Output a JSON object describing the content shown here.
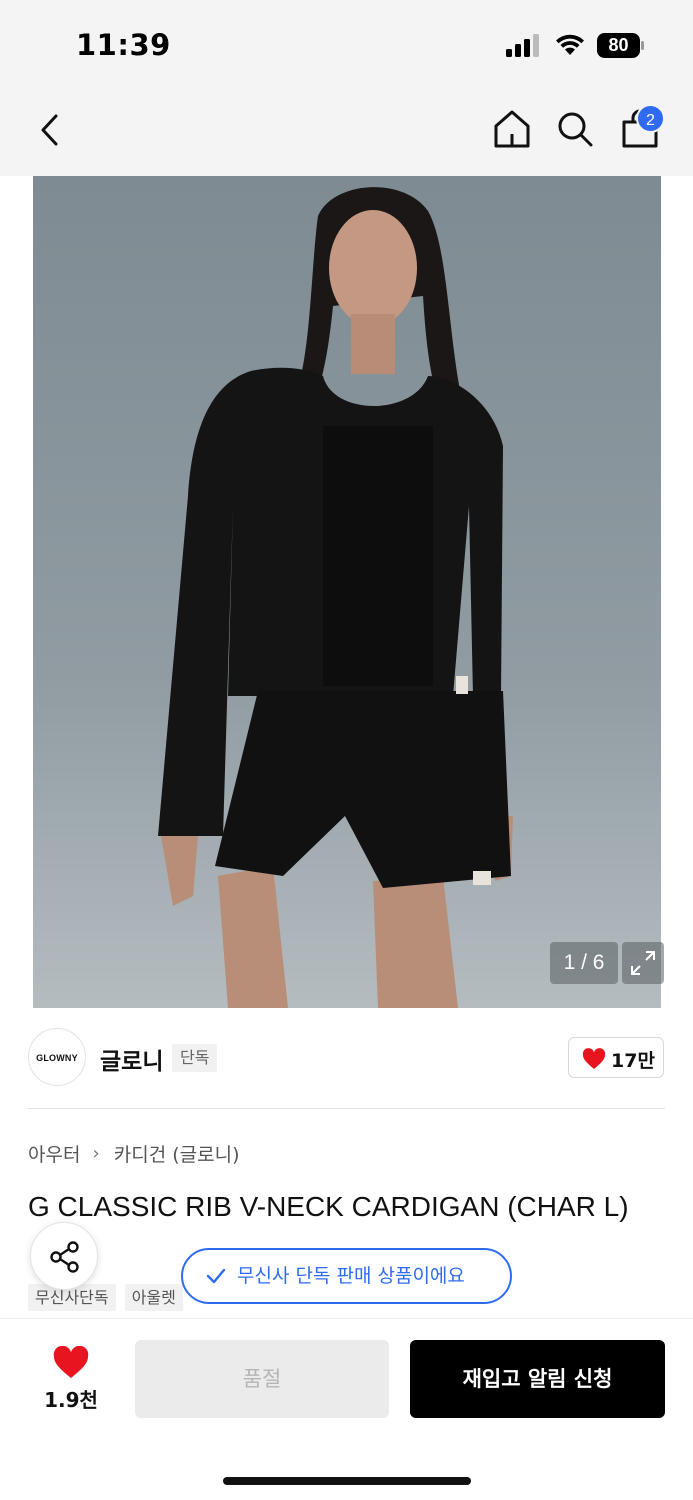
{
  "status_bar": {
    "time": "11:39",
    "battery": "80"
  },
  "nav": {
    "cart_count": "2"
  },
  "gallery": {
    "counter": "1 / 6"
  },
  "brand": {
    "logo_text": "GLOWNY",
    "name": "글로니",
    "exclusive_tag": "단독",
    "likes": "17만"
  },
  "breadcrumb": {
    "category": "아우터",
    "subcategory": "카디건 (글로니)"
  },
  "product": {
    "title": "G CLASSIC RIB V-NECK CARDIGAN (CHAR L)"
  },
  "tags": [
    "무신사단독",
    "아울렛"
  ],
  "toast": {
    "text": "무신사 단독 판매 상품이에요"
  },
  "bottom": {
    "wish_count": "1.9천",
    "soldout_label": "품절",
    "restock_label": "재입고 알림 신청"
  },
  "colors": {
    "accent_blue": "#2f6bf0",
    "heart_red": "#e8141f",
    "primary_black": "#000000"
  },
  "icons": [
    "back-icon",
    "home-icon",
    "search-icon",
    "cart-icon",
    "expand-icon",
    "heart-icon",
    "share-icon",
    "check-icon"
  ]
}
